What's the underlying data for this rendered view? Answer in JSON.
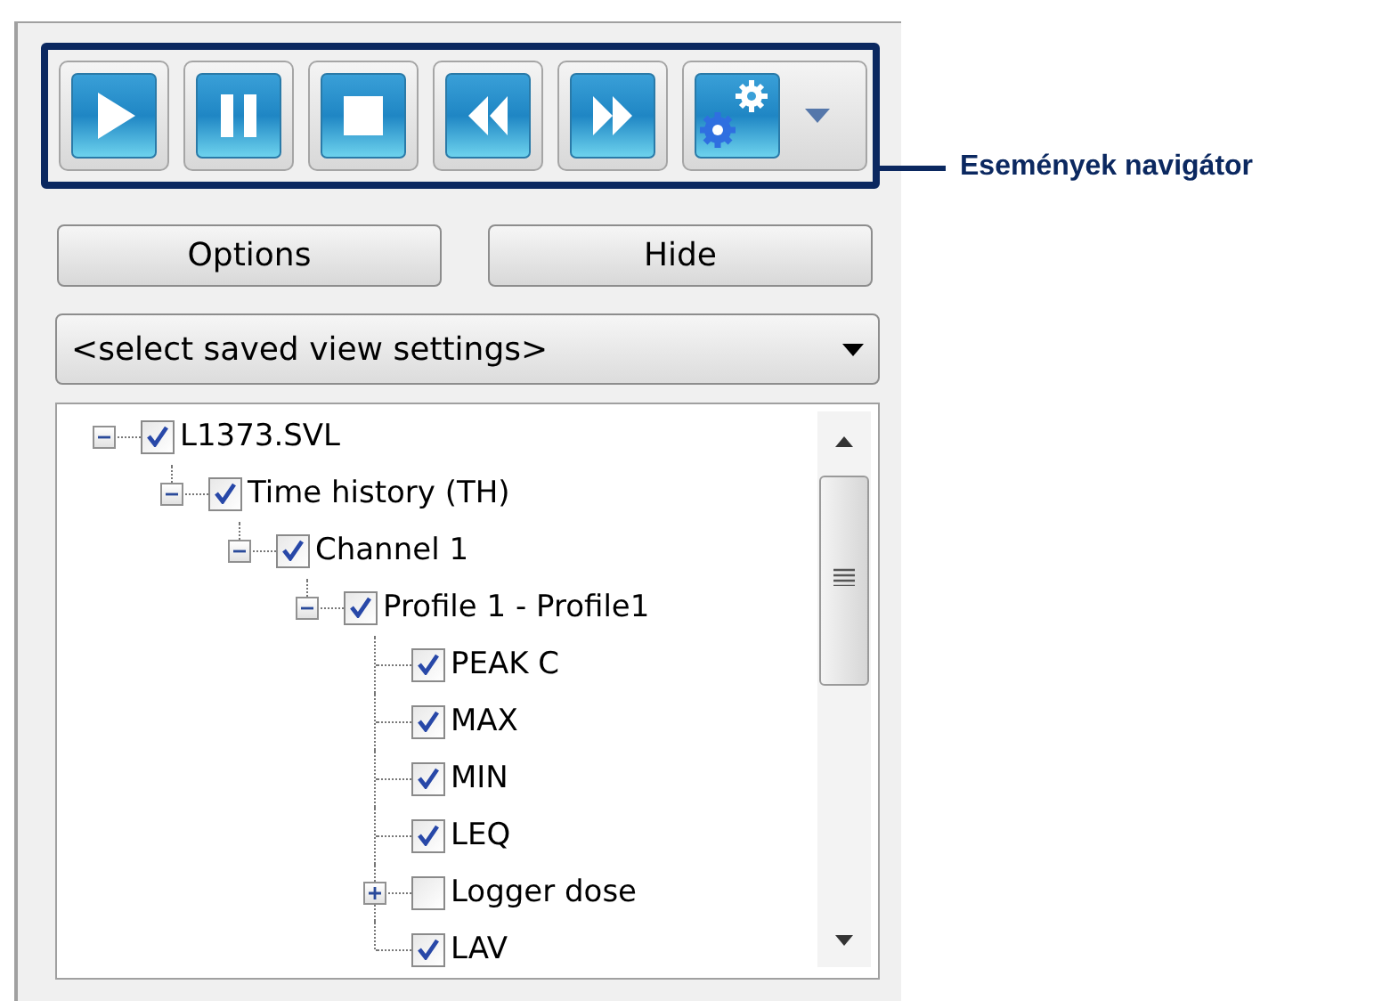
{
  "toolbar": {
    "buttons": [
      {
        "kind": "play"
      },
      {
        "kind": "pause"
      },
      {
        "kind": "stop"
      },
      {
        "kind": "rewind"
      },
      {
        "kind": "forward"
      },
      {
        "kind": "settings"
      }
    ]
  },
  "callout": "Események navigátor",
  "buttons": [
    "Options",
    "Hide"
  ],
  "view_select": {
    "value": "<select saved view settings>"
  },
  "tree": [
    {
      "label": "L1373.SVL",
      "checked": true,
      "expanded": true,
      "children": [
        {
          "label": "Time history (TH)",
          "checked": true,
          "expanded": true,
          "children": [
            {
              "label": "Channel 1",
              "checked": true,
              "expanded": true,
              "children": [
                {
                  "label": "Profile 1 - Profile1",
                  "checked": true,
                  "expanded": true,
                  "children": [
                    {
                      "label": "PEAK C",
                      "checked": true
                    },
                    {
                      "label": "MAX",
                      "checked": true
                    },
                    {
                      "label": "MIN",
                      "checked": true
                    },
                    {
                      "label": "LEQ",
                      "checked": true
                    },
                    {
                      "label": "Logger dose",
                      "checked": false,
                      "expanded": false
                    },
                    {
                      "label": "LAV",
                      "checked": true
                    }
                  ]
                }
              ]
            }
          ]
        }
      ]
    }
  ]
}
